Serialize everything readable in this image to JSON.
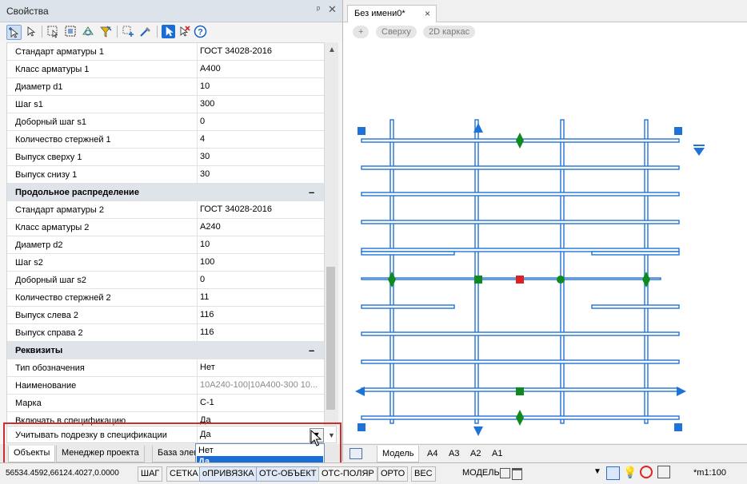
{
  "props": {
    "title": "Свойства",
    "pin_icon": "pin-icon",
    "close_icon": "close-icon",
    "rows": [
      {
        "n": "Стандарт арматуры 1",
        "v": "ГОСТ 34028-2016"
      },
      {
        "n": "Класс арматуры 1",
        "v": "A400"
      },
      {
        "n": "Диаметр d1",
        "v": "10"
      },
      {
        "n": "Шаг s1",
        "v": "300"
      },
      {
        "n": "Доборный шаг s1",
        "v": "0"
      },
      {
        "n": "Количество стержней 1",
        "v": "4"
      },
      {
        "n": "Выпуск сверху 1",
        "v": "30"
      },
      {
        "n": "Выпуск снизу 1",
        "v": "30"
      },
      {
        "n": "Продольное распределение",
        "section": true,
        "m": "–"
      },
      {
        "n": "Стандарт арматуры 2",
        "v": "ГОСТ 34028-2016"
      },
      {
        "n": "Класс арматуры 2",
        "v": "A240"
      },
      {
        "n": "Диаметр d2",
        "v": "10"
      },
      {
        "n": "Шаг s2",
        "v": "100"
      },
      {
        "n": "Доборный шаг s2",
        "v": "0"
      },
      {
        "n": "Количество стержней 2",
        "v": "11"
      },
      {
        "n": "Выпуск слева 2",
        "v": "116"
      },
      {
        "n": "Выпуск справа 2",
        "v": "116"
      },
      {
        "n": "Реквизиты",
        "section": true,
        "m": "–"
      },
      {
        "n": "Тип обозначения",
        "v": "Нет"
      },
      {
        "n": "Наименование",
        "v": "10A240-100|10A400-300 10...",
        "grey": true
      },
      {
        "n": "Марка",
        "v": "С-1"
      },
      {
        "n": "Включать в спецификацию",
        "v": "Да"
      }
    ],
    "selected_row": {
      "n": "Учитывать подрезку в спецификации",
      "v": "Да"
    },
    "dropdown_options": [
      "Нет",
      "Да"
    ],
    "dropdown_selected": "Да",
    "bottom_tabs": [
      "Объекты",
      "Менеджер проекта",
      "База элем"
    ]
  },
  "drawing": {
    "doc_tab": "Без имени0*",
    "doc_tab_close": "×",
    "view_pills": [
      "+",
      "Сверху",
      "2D каркас"
    ],
    "layout_tabs": [
      "Модель",
      "A4",
      "A3",
      "A2",
      "A1"
    ],
    "colors": {
      "rebar": "#1e73d8",
      "grip_green": "#0f8a1e",
      "grip_red": "#e02020",
      "grip_blue": "#1e73d8"
    }
  },
  "status": {
    "coords": "56534.4592,66124.4027,0.0000",
    "toggles": [
      "ШАГ",
      "СЕТКА",
      "оПРИВЯЗКА",
      "ОТС-ОБЪЕКТ",
      "ОТС-ПОЛЯР",
      "ОРТО",
      "ВЕС"
    ],
    "model_label": "МОДЕЛЬ",
    "scale": "*m1:100"
  }
}
